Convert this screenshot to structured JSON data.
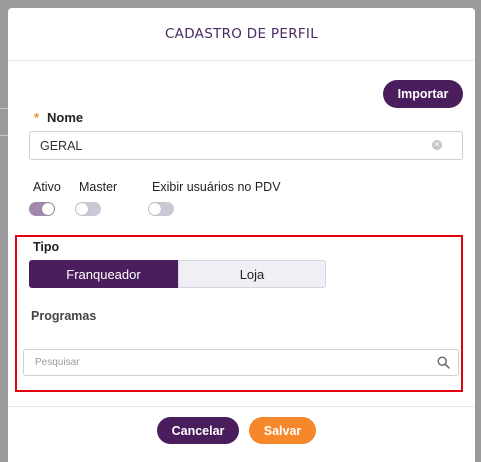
{
  "modal": {
    "title": "CADASTRO DE PERFIL",
    "import_button": "Importar"
  },
  "form": {
    "nome": {
      "required_mark": "*",
      "label": "Nome",
      "value": "GERAL"
    },
    "toggles": [
      {
        "label": "Ativo",
        "state": "on"
      },
      {
        "label": "Master",
        "state": "off"
      },
      {
        "label": "Exibir usuários no PDV",
        "state": "off"
      }
    ],
    "tipo": {
      "label": "Tipo",
      "options": [
        "Franqueador",
        "Loja"
      ],
      "selected": "Franqueador"
    },
    "programas": {
      "label": "Programas",
      "search_placeholder": "Pesquisar"
    }
  },
  "footer": {
    "cancel_button": "Cancelar",
    "save_button": "Salvar"
  },
  "colors": {
    "primary": "#4a1d5c",
    "accent": "#f6872b",
    "highlight": "#e0000f",
    "required": "#f08a2c"
  },
  "icons": {
    "clear": "clear-icon",
    "search": "search-icon"
  }
}
